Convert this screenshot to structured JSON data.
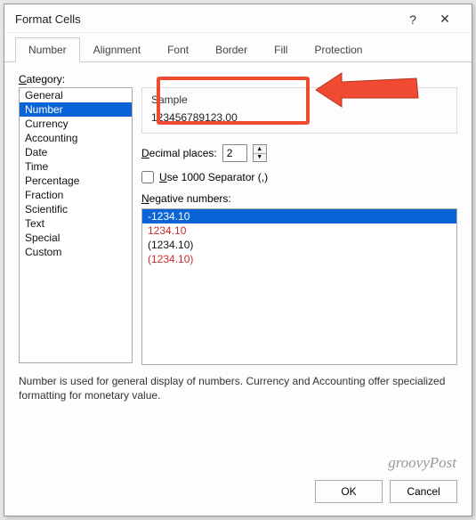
{
  "dialog": {
    "title": "Format Cells",
    "help": "?",
    "close": "✕"
  },
  "tabs": [
    {
      "label": "Number",
      "active": true
    },
    {
      "label": "Alignment",
      "active": false
    },
    {
      "label": "Font",
      "active": false
    },
    {
      "label": "Border",
      "active": false
    },
    {
      "label": "Fill",
      "active": false
    },
    {
      "label": "Protection",
      "active": false
    }
  ],
  "category": {
    "label_pre": "C",
    "label_rest": "ategory:",
    "items": [
      {
        "label": "General",
        "selected": false
      },
      {
        "label": "Number",
        "selected": true
      },
      {
        "label": "Currency",
        "selected": false
      },
      {
        "label": "Accounting",
        "selected": false
      },
      {
        "label": "Date",
        "selected": false
      },
      {
        "label": "Time",
        "selected": false
      },
      {
        "label": "Percentage",
        "selected": false
      },
      {
        "label": "Fraction",
        "selected": false
      },
      {
        "label": "Scientific",
        "selected": false
      },
      {
        "label": "Text",
        "selected": false
      },
      {
        "label": "Special",
        "selected": false
      },
      {
        "label": "Custom",
        "selected": false
      }
    ]
  },
  "sample": {
    "label": "Sample",
    "value": "123456789123.00"
  },
  "decimal": {
    "label_pre": "D",
    "label_rest": "ecimal places:",
    "value": "2"
  },
  "separator": {
    "checked": false,
    "label_pre": "U",
    "label_rest": "se 1000 Separator (,)"
  },
  "negative": {
    "label_pre": "N",
    "label_rest": "egative numbers:",
    "items": [
      {
        "label": "-1234.10",
        "color": "#ffffff",
        "selected": true
      },
      {
        "label": "1234.10",
        "color": "#d02a2a",
        "selected": false
      },
      {
        "label": "(1234.10)",
        "color": "#111111",
        "selected": false
      },
      {
        "label": "(1234.10)",
        "color": "#d02a2a",
        "selected": false
      }
    ]
  },
  "description": "Number is used for general display of numbers.  Currency and Accounting offer specialized formatting for monetary value.",
  "buttons": {
    "ok": "OK",
    "cancel": "Cancel"
  },
  "watermark": "groovyPost",
  "callout_color": "#f04b32"
}
